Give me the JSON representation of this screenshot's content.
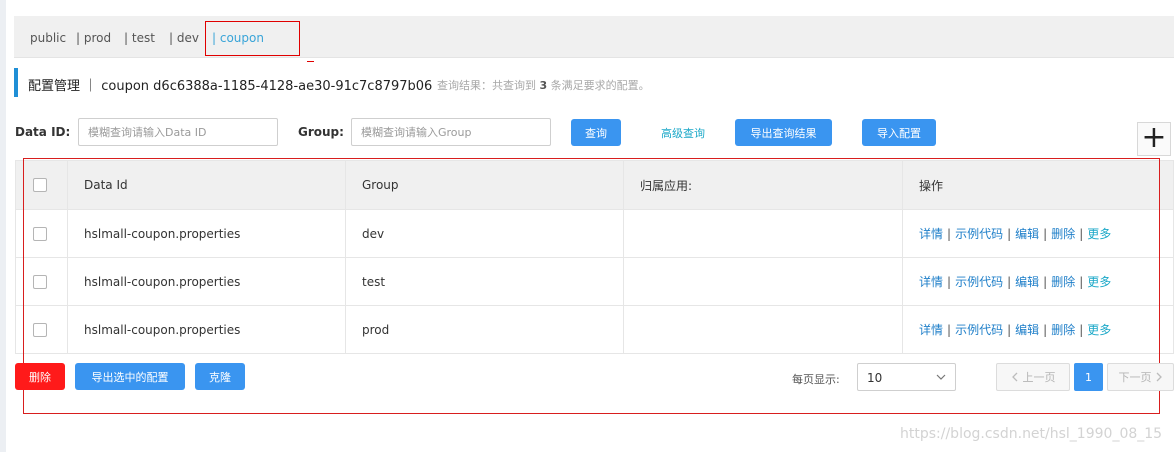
{
  "namespaces": {
    "items": [
      "public",
      "| prod",
      "| test",
      "| dev",
      "| coupon"
    ]
  },
  "title": {
    "text": "配置管理 ｜ coupon  d6c6388a-1185-4128-ae30-91c7c8797b06",
    "info_prefix": "查询结果：共查询到",
    "info_count": "3",
    "info_suffix": "条满足要求的配置。"
  },
  "search": {
    "dataid_label": "Data ID:",
    "dataid_placeholder": "模糊查询请输入Data ID",
    "group_label": "Group:",
    "group_placeholder": "模糊查询请输入Group",
    "query_button": "查询",
    "advanced_link": "高级查询",
    "export_results_button": "导出查询结果",
    "import_button": "导入配置",
    "add_button": "+"
  },
  "table": {
    "headers": [
      "Data Id",
      "Group",
      "归属应用:",
      "操作"
    ],
    "rows": [
      {
        "data_id": "hslmall-coupon.properties",
        "group": "dev",
        "app": ""
      },
      {
        "data_id": "hslmall-coupon.properties",
        "group": "test",
        "app": ""
      },
      {
        "data_id": "hslmall-coupon.properties",
        "group": "prod",
        "app": ""
      }
    ],
    "actions": [
      "详情",
      "示例代码",
      "编辑",
      "删除",
      "更多"
    ]
  },
  "bottom": {
    "delete_button": "删除",
    "export_selected_button": "导出选中的配置",
    "clone_button": "克隆",
    "page_size_label": "每页显示:",
    "page_size_value": "10",
    "prev": "上一页",
    "page_current": "1",
    "next": "下一页"
  },
  "watermark": "https://blog.csdn.net/hsl_1990_08_15"
}
